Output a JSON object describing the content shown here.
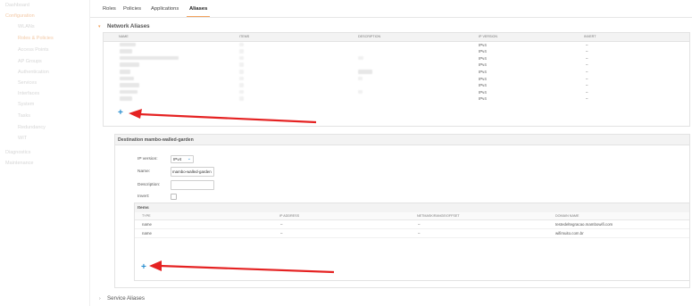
{
  "sidebar": {
    "items": [
      {
        "label": "Dashboard"
      },
      {
        "label": "Configuration"
      },
      {
        "label": "WLANs"
      },
      {
        "label": "Roles & Policies"
      },
      {
        "label": "Access Points"
      },
      {
        "label": "AP Groups"
      },
      {
        "label": "Authentication"
      },
      {
        "label": "Services"
      },
      {
        "label": "Interfaces"
      },
      {
        "label": "System"
      },
      {
        "label": "Tasks"
      },
      {
        "label": "Redundancy"
      },
      {
        "label": "WIT"
      },
      {
        "label": "Diagnostics"
      },
      {
        "label": "Maintenance"
      }
    ]
  },
  "tabs": [
    {
      "label": "Roles"
    },
    {
      "label": "Policies"
    },
    {
      "label": "Applications"
    },
    {
      "label": "Aliases"
    }
  ],
  "network_aliases": {
    "title": "Network Aliases",
    "columns": [
      "NAME",
      "ITEMS",
      "DESCRIPTION",
      "IP VERSION",
      "INVERT"
    ],
    "rows": [
      {
        "ip_version": "IPv4",
        "invert": "–"
      },
      {
        "ip_version": "IPv4",
        "invert": "–"
      },
      {
        "ip_version": "IPv4",
        "invert": "–"
      },
      {
        "ip_version": "IPv4",
        "invert": "–"
      },
      {
        "ip_version": "IPv4",
        "invert": "–"
      },
      {
        "ip_version": "IPv4",
        "invert": "–"
      },
      {
        "ip_version": "IPv4",
        "invert": "–"
      },
      {
        "ip_version": "IPv4",
        "invert": "–"
      },
      {
        "ip_version": "IPv4",
        "invert": "–"
      }
    ],
    "add_label": "+"
  },
  "destination": {
    "title": "Destination mambo-walled-garden",
    "ip_version_label": "IP version:",
    "ip_version_value": "IPv4",
    "name_label": "Name:",
    "name_value": "mambo-walled-garden",
    "description_label": "Description:",
    "description_value": "",
    "invert_label": "Invert:",
    "items": {
      "title": "Items",
      "columns": [
        "TYPE",
        "IP ADDRESS",
        "NETMASK/RANGE/OFFSET",
        "DOMAIN NAME"
      ],
      "rows": [
        {
          "type": "name",
          "ip": "–",
          "netmask": "–",
          "domain": "testedeltegracao.mambowifi.com"
        },
        {
          "type": "name",
          "ip": "–",
          "netmask": "–",
          "domain": "wifimuito.com.br"
        }
      ],
      "add_label": "+"
    }
  },
  "service_aliases": {
    "title": "Service Aliases"
  },
  "colors": {
    "accent": "#f2a25c",
    "link": "#2a8fd0",
    "arrow": "#e52222"
  }
}
